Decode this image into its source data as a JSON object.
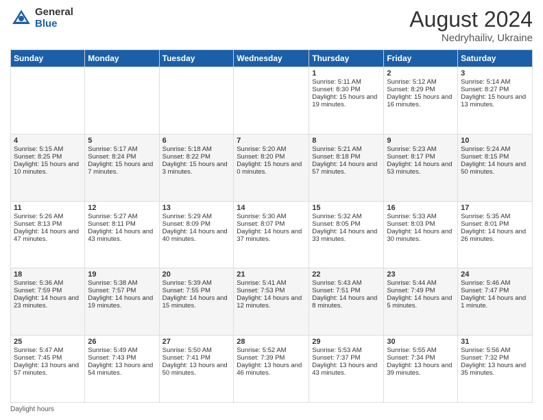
{
  "header": {
    "logo_general": "General",
    "logo_blue": "Blue",
    "month_year": "August 2024",
    "location": "Nedryhailiv, Ukraine"
  },
  "footer": {
    "note": "Daylight hours"
  },
  "columns": [
    "Sunday",
    "Monday",
    "Tuesday",
    "Wednesday",
    "Thursday",
    "Friday",
    "Saturday"
  ],
  "weeks": [
    {
      "row_bg": "white",
      "days": [
        {
          "num": "",
          "content": ""
        },
        {
          "num": "",
          "content": ""
        },
        {
          "num": "",
          "content": ""
        },
        {
          "num": "",
          "content": ""
        },
        {
          "num": "1",
          "content": "Sunrise: 5:11 AM\nSunset: 8:30 PM\nDaylight: 15 hours and 19 minutes."
        },
        {
          "num": "2",
          "content": "Sunrise: 5:12 AM\nSunset: 8:29 PM\nDaylight: 15 hours and 16 minutes."
        },
        {
          "num": "3",
          "content": "Sunrise: 5:14 AM\nSunset: 8:27 PM\nDaylight: 15 hours and 13 minutes."
        }
      ]
    },
    {
      "row_bg": "gray",
      "days": [
        {
          "num": "4",
          "content": "Sunrise: 5:15 AM\nSunset: 8:25 PM\nDaylight: 15 hours and 10 minutes."
        },
        {
          "num": "5",
          "content": "Sunrise: 5:17 AM\nSunset: 8:24 PM\nDaylight: 15 hours and 7 minutes."
        },
        {
          "num": "6",
          "content": "Sunrise: 5:18 AM\nSunset: 8:22 PM\nDaylight: 15 hours and 3 minutes."
        },
        {
          "num": "7",
          "content": "Sunrise: 5:20 AM\nSunset: 8:20 PM\nDaylight: 15 hours and 0 minutes."
        },
        {
          "num": "8",
          "content": "Sunrise: 5:21 AM\nSunset: 8:18 PM\nDaylight: 14 hours and 57 minutes."
        },
        {
          "num": "9",
          "content": "Sunrise: 5:23 AM\nSunset: 8:17 PM\nDaylight: 14 hours and 53 minutes."
        },
        {
          "num": "10",
          "content": "Sunrise: 5:24 AM\nSunset: 8:15 PM\nDaylight: 14 hours and 50 minutes."
        }
      ]
    },
    {
      "row_bg": "white",
      "days": [
        {
          "num": "11",
          "content": "Sunrise: 5:26 AM\nSunset: 8:13 PM\nDaylight: 14 hours and 47 minutes."
        },
        {
          "num": "12",
          "content": "Sunrise: 5:27 AM\nSunset: 8:11 PM\nDaylight: 14 hours and 43 minutes."
        },
        {
          "num": "13",
          "content": "Sunrise: 5:29 AM\nSunset: 8:09 PM\nDaylight: 14 hours and 40 minutes."
        },
        {
          "num": "14",
          "content": "Sunrise: 5:30 AM\nSunset: 8:07 PM\nDaylight: 14 hours and 37 minutes."
        },
        {
          "num": "15",
          "content": "Sunrise: 5:32 AM\nSunset: 8:05 PM\nDaylight: 14 hours and 33 minutes."
        },
        {
          "num": "16",
          "content": "Sunrise: 5:33 AM\nSunset: 8:03 PM\nDaylight: 14 hours and 30 minutes."
        },
        {
          "num": "17",
          "content": "Sunrise: 5:35 AM\nSunset: 8:01 PM\nDaylight: 14 hours and 26 minutes."
        }
      ]
    },
    {
      "row_bg": "gray",
      "days": [
        {
          "num": "18",
          "content": "Sunrise: 5:36 AM\nSunset: 7:59 PM\nDaylight: 14 hours and 23 minutes."
        },
        {
          "num": "19",
          "content": "Sunrise: 5:38 AM\nSunset: 7:57 PM\nDaylight: 14 hours and 19 minutes."
        },
        {
          "num": "20",
          "content": "Sunrise: 5:39 AM\nSunset: 7:55 PM\nDaylight: 14 hours and 15 minutes."
        },
        {
          "num": "21",
          "content": "Sunrise: 5:41 AM\nSunset: 7:53 PM\nDaylight: 14 hours and 12 minutes."
        },
        {
          "num": "22",
          "content": "Sunrise: 5:43 AM\nSunset: 7:51 PM\nDaylight: 14 hours and 8 minutes."
        },
        {
          "num": "23",
          "content": "Sunrise: 5:44 AM\nSunset: 7:49 PM\nDaylight: 14 hours and 5 minutes."
        },
        {
          "num": "24",
          "content": "Sunrise: 5:46 AM\nSunset: 7:47 PM\nDaylight: 14 hours and 1 minute."
        }
      ]
    },
    {
      "row_bg": "white",
      "days": [
        {
          "num": "25",
          "content": "Sunrise: 5:47 AM\nSunset: 7:45 PM\nDaylight: 13 hours and 57 minutes."
        },
        {
          "num": "26",
          "content": "Sunrise: 5:49 AM\nSunset: 7:43 PM\nDaylight: 13 hours and 54 minutes."
        },
        {
          "num": "27",
          "content": "Sunrise: 5:50 AM\nSunset: 7:41 PM\nDaylight: 13 hours and 50 minutes."
        },
        {
          "num": "28",
          "content": "Sunrise: 5:52 AM\nSunset: 7:39 PM\nDaylight: 13 hours and 46 minutes."
        },
        {
          "num": "29",
          "content": "Sunrise: 5:53 AM\nSunset: 7:37 PM\nDaylight: 13 hours and 43 minutes."
        },
        {
          "num": "30",
          "content": "Sunrise: 5:55 AM\nSunset: 7:34 PM\nDaylight: 13 hours and 39 minutes."
        },
        {
          "num": "31",
          "content": "Sunrise: 5:56 AM\nSunset: 7:32 PM\nDaylight: 13 hours and 35 minutes."
        }
      ]
    }
  ]
}
